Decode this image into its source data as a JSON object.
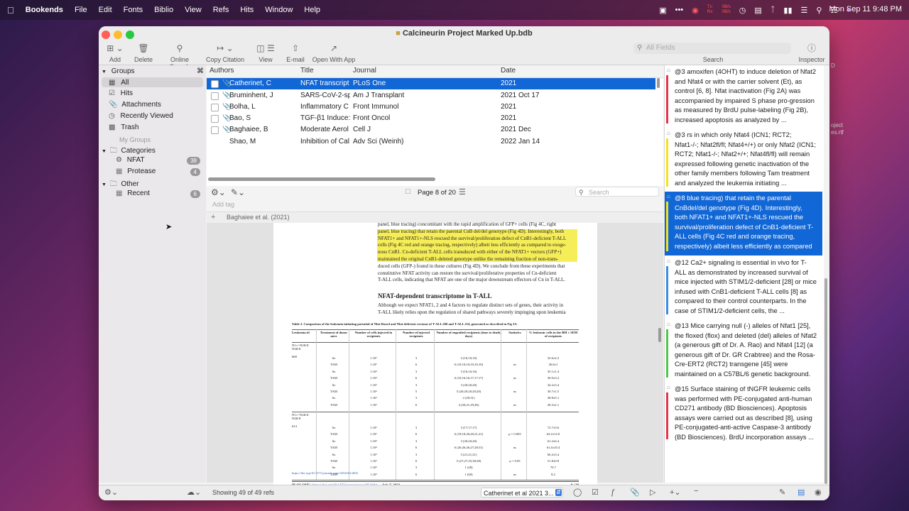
{
  "menubar": {
    "apple_icon": "apple-icon",
    "app_name": "Bookends",
    "items": [
      "File",
      "Edit",
      "Fonts",
      "Biblio",
      "View",
      "Refs",
      "Hits",
      "Window",
      "Help"
    ],
    "net_tx": "Tx:",
    "net_rx": "Rx:",
    "net_tx_val": "0B/s",
    "net_rx_val": "0B/s",
    "clock": "Mon Sep 11  9:48 PM"
  },
  "window": {
    "title": "Calcineurin Project Marked Up.bdb",
    "toolbar": {
      "add": "Add",
      "delete": "Delete",
      "online_search": "Online Search",
      "copy_citation": "Copy Citation",
      "view": "View",
      "email": "E-mail",
      "open_with_app": "Open With App",
      "search": "Search",
      "inspector": "Inspector",
      "search_placeholder": "All Fields"
    }
  },
  "sidebar": {
    "groups_label": "Groups",
    "items": [
      {
        "label": "All"
      },
      {
        "label": "Hits"
      },
      {
        "label": "Attachments"
      },
      {
        "label": "Recently Viewed"
      },
      {
        "label": "Trash"
      }
    ],
    "my_groups_label": "My Groups",
    "categories_label": "Categories",
    "categories": [
      {
        "label": "NFAT",
        "count": "38"
      },
      {
        "label": "Protease",
        "count": "4"
      }
    ],
    "other_label": "Other",
    "other": [
      {
        "label": "Recent",
        "count": "6"
      }
    ]
  },
  "table": {
    "headers": {
      "authors": "Authors",
      "title": "Title",
      "journal": "Journal",
      "date": "Date"
    },
    "rows": [
      {
        "author": "Catherinet, C",
        "title": "NFAT transcript",
        "journal": "PLoS One",
        "date": "2021"
      },
      {
        "author": "Bruminhent, J",
        "title": "SARS-CoV-2-sp",
        "journal": "Am J Transplant",
        "date": "2021 Oct 17"
      },
      {
        "author": "Bolha, L",
        "title": "Inflammatory C",
        "journal": "Front Immunol",
        "date": "2021"
      },
      {
        "author": "Bao, S",
        "title": "TGF-β1 Induce:",
        "journal": "Front Oncol",
        "date": "2021"
      },
      {
        "author": "Baghaiee, B",
        "title": "Moderate Aerol",
        "journal": "Cell J",
        "date": "2021 Dec"
      },
      {
        "author": "Shao, M",
        "title": "Inhibition of Cal",
        "journal": "Adv Sci (Weinh)",
        "date": "2022 Jan 14"
      }
    ],
    "selected_row": 0
  },
  "pager": {
    "page_text": "Page 8 of 20",
    "search_placeholder": "Search",
    "add_tag": "Add tag",
    "tag_crumb": "Baghaiee et al. (2021)"
  },
  "pdf": {
    "para1_lines": [
      "panel, blue tracing) concomitant with the rapid amplification of GFP+ cells (Fig 4C, right",
      "panel, blue tracing) that retain the parental CnB del/del genotype (Fig 4D). Interestingly, both",
      "NFAT1+ and NFAT1+-NLS rescued the survival/proliferation defect of CnB1-deficient T-ALL",
      "cells (Fig 4C red and orange tracing, respectively) albeit less efficiently as compared to exoge-",
      "nous CnB1. Cn-deficient T-ALL cells transduced with either of the NFAT1+ vectors (GFP+)",
      "maintained the original CnB1-deleted genotype unlike the remaining fraction of non-trans-",
      "duced cells (GFP-) found in these cultures (Fig 4D). We conclude from these experiments that",
      "constitutive NFAT activity can restore the survival/proliferative properties of Cn-deficient",
      "T-ALL cells, indicating that NFAT are one of the major downstream effectors of Cn in T-ALL."
    ],
    "heading": "NFAT-dependent transcriptome in T-ALL",
    "para2_lines": [
      "Although we expect NFAT1, 2 and 4 factors to regulate distinct sets of genes, their activity in",
      "T-ALL likely relies upon the regulation of shared pathways severely impinging upon leukemia"
    ],
    "table_caption": "Table 2.  Comparison of the leukemia initiating potential of Nfat-floxed and Nfat-deficient versions of T-ALL #68 and T-ALL #14, generated as described in Fig 3A.",
    "table_headers": [
      "Leukemia id",
      "Treatment of donor mice",
      "Number of cells injected in recipients",
      "Number of injected recipients",
      "Number of engrafted recipients (time to death, days)",
      "Statistics",
      "% leukemic cells in the BM ± SEM of recipients"
    ],
    "group1_id": "N1+/-N2fl/fl N4fl/fl",
    "group1_num": "#68",
    "group1_rows": [
      [
        "So",
        "1.10⁶",
        "3",
        "3 (10;10;10)",
        "",
        "32.6±2.2"
      ],
      [
        "TAM",
        "1.10⁶",
        "6",
        "6 (10;10;10;10;10;10)",
        "ns",
        "26.6±1"
      ],
      [
        "So",
        "1.10⁴",
        "3",
        "3 (16;16;16)",
        "",
        "35.1±1.4"
      ],
      [
        "TAM",
        "1.10⁴",
        "6",
        "6 (16;16;16;17;17;17)",
        "ns",
        "30.9±3.2"
      ],
      [
        "So",
        "1.10³",
        "3",
        "3 (20;20;20)",
        "",
        "34.2±3.4"
      ],
      [
        "TAM",
        "1.10³",
        "5",
        "5 (20;20;20;20;20)",
        "ns",
        "30.7±1.5"
      ],
      [
        "So",
        "1.10²",
        "3",
        "2 (20;31)",
        "",
        "38.8±5.1"
      ],
      [
        "TAM",
        "1.10²",
        "6",
        "4 (20;21;29;46)",
        "ns",
        "28.3±2.1"
      ]
    ],
    "group2_id": "N1+/-N2fl/fl N4fl/fl",
    "group2_num": "#14",
    "group2_rows": [
      [
        "So",
        "1.10⁶",
        "3",
        "3 (17;17;17)",
        "",
        "72.7±3.6"
      ],
      [
        "TAM",
        "1.10⁶",
        "6",
        "6 (18;18;20;20;21;21)",
        "p = 0.005",
        "62.2±12.0"
      ],
      [
        "So",
        "1.10⁴",
        "3",
        "3 (20;20;20)",
        "",
        "61.2±6.4"
      ],
      [
        "TAM",
        "1.10⁴",
        "6",
        "6 (26;26;26;27;28;31)",
        "ns",
        "61.4±10.4"
      ],
      [
        "So",
        "1.10³",
        "3",
        "3 (21;21;21)",
        "",
        "66.2±3.4"
      ],
      [
        "TAM",
        "1.10³",
        "6",
        "5 (27;27;35;38;38)",
        "p = 0.05",
        "51.8±0.8"
      ],
      [
        "So",
        "1.10²",
        "3",
        "1 (28)",
        "",
        "70.7"
      ],
      [
        "TAM",
        "1.10²",
        "6",
        "1 (60)",
        "ns",
        "8.2"
      ]
    ],
    "doi": "https://doi.org/10.1371/journal.pone.0254184.t002",
    "footer_journal": "PLOS ONE",
    "footer_doi": "https://doi.org/10.1371/journal.pone.0254184",
    "footer_date": "July 7, 2021",
    "footer_page": "8 / 20"
  },
  "notes": [
    {
      "text": "@3 amoxifen (4OHT) to induce deletion of Nfat2 and Nfat4 or with the carrier solvent (Et), as control [6, 8]. Nfat inactivation (Fig 2A) was accompanied by impaired S phase pro-gression as measured by BrdU pulse-labeling (Fig 2B), increased apoptosis as analyzed by ...",
      "color": "#e8334a"
    },
    {
      "text": "@3 rs in which only Nfat4 (ICN1; RCT2; Nfat1-/-; Nfat2fl/fl; Nfat4+/+) or only Nfat2 (ICN1; RCT2; Nfat1-/-; Nfat2+/+; Nfat4fl/fl) will remain expressed following genetic inactivation of the other family members following Tam treatment and analyzed the leukemia initiating ...",
      "color": "#f4e21a"
    },
    {
      "text": "@8 blue tracing) that retain the parental CnBdel/del genotype (Fig 4D). Interestingly, both NFAT1+ and NFAT1+-NLS rescued the survival/proliferation defect of CnB1-deficient T-ALL cells (Fig 4C red and orange tracing, respectively) albeit less efficiently as compared ...",
      "color": "#f4e21a"
    },
    {
      "text": "@12 Ca2+ signaling is essential in vivo for T-ALL as demonstrated by increased survival of mice injected with STIM1/2-deficient [28] or mice infused with CnB1-deficient T-ALL cells [8] as compared to their control counterparts. In the case of STIM1/2-deficient cells, the ...",
      "color": "#3a8be8"
    },
    {
      "text": "@13 Mice carrying null (-) alleles of Nfat1 [25], the floxed (flox) and deleted (del) alleles of Nfat2 (a generous gift of Dr. A. Rao) and Nfat4 [12] (a generous gift of Dr. GR Crabtree) and the Rosa-Cre-ERT2 (RCT2) transgene [45] were maintained on a C57BL/6 genetic background. ...",
      "color": "#4cc84a"
    },
    {
      "text": "@15 Surface staining of tNGFR leukemic cells was performed with PE-conjugated anti-human CD271 antibody (BD Biosciences). Apoptosis assays were carried out as described [8], using PE-conjugated-anti-active Caspase-3 antibody (BD Biosciences). BrdU incorporation assays ...",
      "color": "#e8334a"
    }
  ],
  "status": {
    "count": "Showing 49 of 49 refs",
    "citation": "Catherinet et al 2021 3..."
  },
  "desktop": {
    "file_label_1": "oject",
    "file_label_2": "es.rtf",
    "file_label_3": "D"
  }
}
